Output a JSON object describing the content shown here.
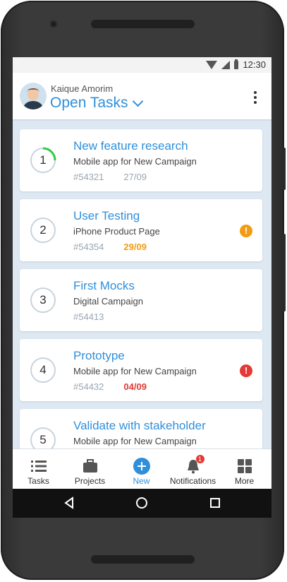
{
  "status": {
    "time": "12:30"
  },
  "header": {
    "user_name": "Kaique Amorim",
    "title": "Open Tasks"
  },
  "tasks": [
    {
      "num": "1",
      "title": "New feature research",
      "subtitle": "Mobile app for New Campaign",
      "id": "#54321",
      "due": "27/09",
      "due_state": "normal",
      "progress": 0.25,
      "alert": ""
    },
    {
      "num": "2",
      "title": "User Testing",
      "subtitle": "iPhone Product Page",
      "id": "#54354",
      "due": "29/09",
      "due_state": "warn",
      "progress": 0,
      "alert": "!"
    },
    {
      "num": "3",
      "title": "First Mocks",
      "subtitle": "Digital Campaign",
      "id": "#54413",
      "due": "",
      "due_state": "normal",
      "progress": 0,
      "alert": ""
    },
    {
      "num": "4",
      "title": "Prototype",
      "subtitle": "Mobile app for New Campaign",
      "id": "#54432",
      "due": "04/09",
      "due_state": "late",
      "progress": 0,
      "alert": "!"
    },
    {
      "num": "5",
      "title": "Validate with stakeholder",
      "subtitle": "Mobile app for New Campaign",
      "id": "",
      "due": "",
      "due_state": "normal",
      "progress": 0,
      "alert": ""
    }
  ],
  "tabs": [
    {
      "label": "Tasks",
      "icon": "list-icon"
    },
    {
      "label": "Projects",
      "icon": "briefcase-icon"
    },
    {
      "label": "New",
      "icon": "plus-circle-icon"
    },
    {
      "label": "Notifications",
      "icon": "bell-icon",
      "badge": "1"
    },
    {
      "label": "More",
      "icon": "grid-icon"
    }
  ],
  "colors": {
    "accent": "#2f8fdb",
    "warn": "#f39c12",
    "late": "#e53935",
    "progress": "#2ecc40"
  }
}
